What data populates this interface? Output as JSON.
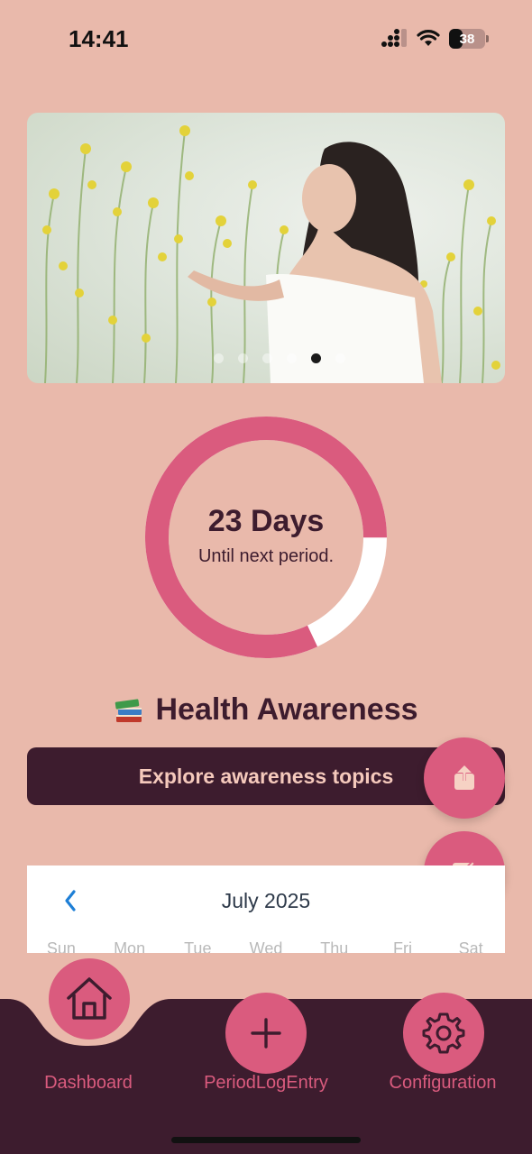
{
  "status_bar": {
    "time": "14:41",
    "battery": "38",
    "battery_level": 0.38
  },
  "hero": {
    "slide_count": 6,
    "active_slide": 4
  },
  "cycle": {
    "days_value": "23 Days",
    "subtitle": "Until next period.",
    "progress_fraction": 0.82,
    "colors": {
      "ring": "#da5b7e",
      "remaining": "#ffffff"
    }
  },
  "awareness": {
    "title": "Health Awareness",
    "icon": "books-icon",
    "explore_label": "Explore awareness topics"
  },
  "fabs": {
    "share_icon": "share-icon",
    "edit_icon": "edit-icon"
  },
  "calendar": {
    "month": "July 2025",
    "weekdays": [
      "Sun",
      "Mon",
      "Tue",
      "Wed",
      "Thu",
      "Fri",
      "Sat"
    ]
  },
  "nav": {
    "items": [
      {
        "label": "Dashboard",
        "icon": "home-icon",
        "active": true
      },
      {
        "label": "PeriodLogEntry",
        "icon": "plus-icon",
        "active": false
      },
      {
        "label": "Configuration",
        "icon": "gear-icon",
        "active": false
      }
    ]
  },
  "colors": {
    "background": "#e9b9ab",
    "accent": "#da5b7e",
    "dark": "#3d1c2e",
    "button_text": "#f5c9bc"
  }
}
